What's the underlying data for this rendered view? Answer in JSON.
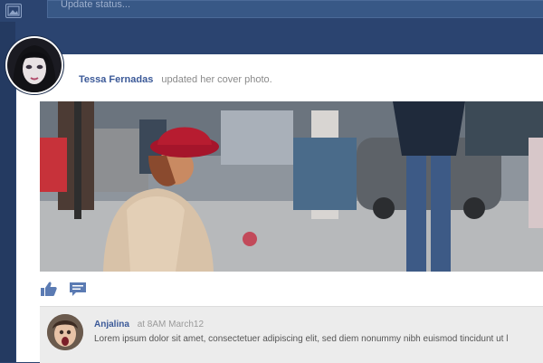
{
  "composer": {
    "status_placeholder": "Update status..."
  },
  "post": {
    "author": "Tessa Fernadas",
    "action_text": "updated her cover photo."
  },
  "actions": {
    "like_icon": "thumbs-up-icon",
    "comment_icon": "comment-icon"
  },
  "comment": {
    "author": "Anjalina",
    "time": "at 8AM March12",
    "text": "Lorem ipsum dolor sit amet, consectetuer adipiscing elit, sed diem nonummy nibh euismod tincidunt ut l"
  },
  "colors": {
    "background": "#2b4470",
    "accent": "#3b5998",
    "card": "#ffffff"
  }
}
